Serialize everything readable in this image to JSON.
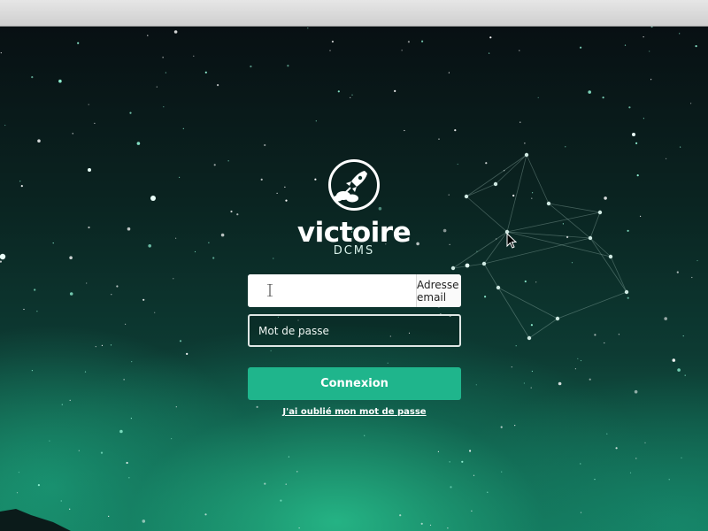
{
  "brand": {
    "name": "victoire",
    "subtitle": "DCMS",
    "logo_icon": "rocket-icon"
  },
  "login_form": {
    "email_value": "",
    "email_addon": "Adresse email",
    "password_placeholder": "Mot de passe",
    "submit_label": "Connexion",
    "forgot_link": "J'ai oublié mon mot de passe"
  },
  "colors": {
    "accent": "#1fb58c",
    "background_dark": "#081013",
    "background_glow": "#127458"
  }
}
